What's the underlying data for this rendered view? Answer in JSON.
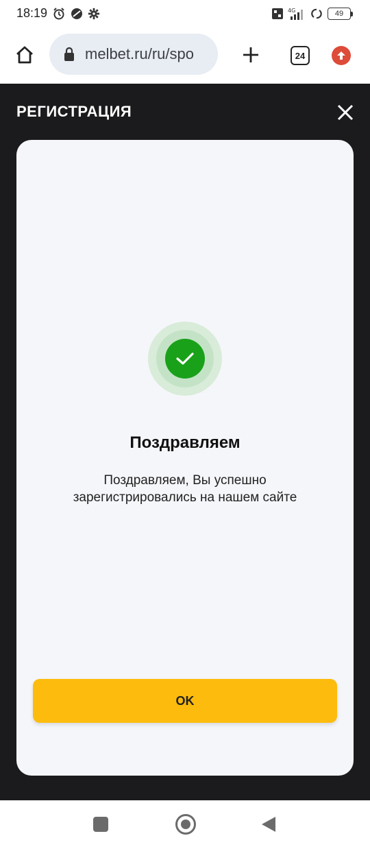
{
  "status_bar": {
    "time": "18:19",
    "battery": "49",
    "icons": [
      "alarm-icon",
      "vpn-icon",
      "settings-icon",
      "volte-icon",
      "signal-4g-icon",
      "sync-icon",
      "battery-icon"
    ]
  },
  "browser": {
    "url": "melbet.ru/ru/spo",
    "tab_count": "24",
    "icons": [
      "home-icon",
      "lock-icon",
      "plus-icon",
      "tabs-icon",
      "update-icon"
    ]
  },
  "modal": {
    "title": "РЕГИСТРАЦИЯ",
    "success_heading": "Поздравляем",
    "success_message": "Поздравляем, Вы успешно зарегистрировались на нашем сайте",
    "ok_label": "OK"
  },
  "colors": {
    "overlay": "#1b1b1d",
    "card": "#f5f6fa",
    "success_green": "#1aa11a",
    "ok_button": "#fdbc0d"
  },
  "nav": {
    "icons": [
      "recents-icon",
      "home-circle-icon",
      "back-icon"
    ]
  }
}
